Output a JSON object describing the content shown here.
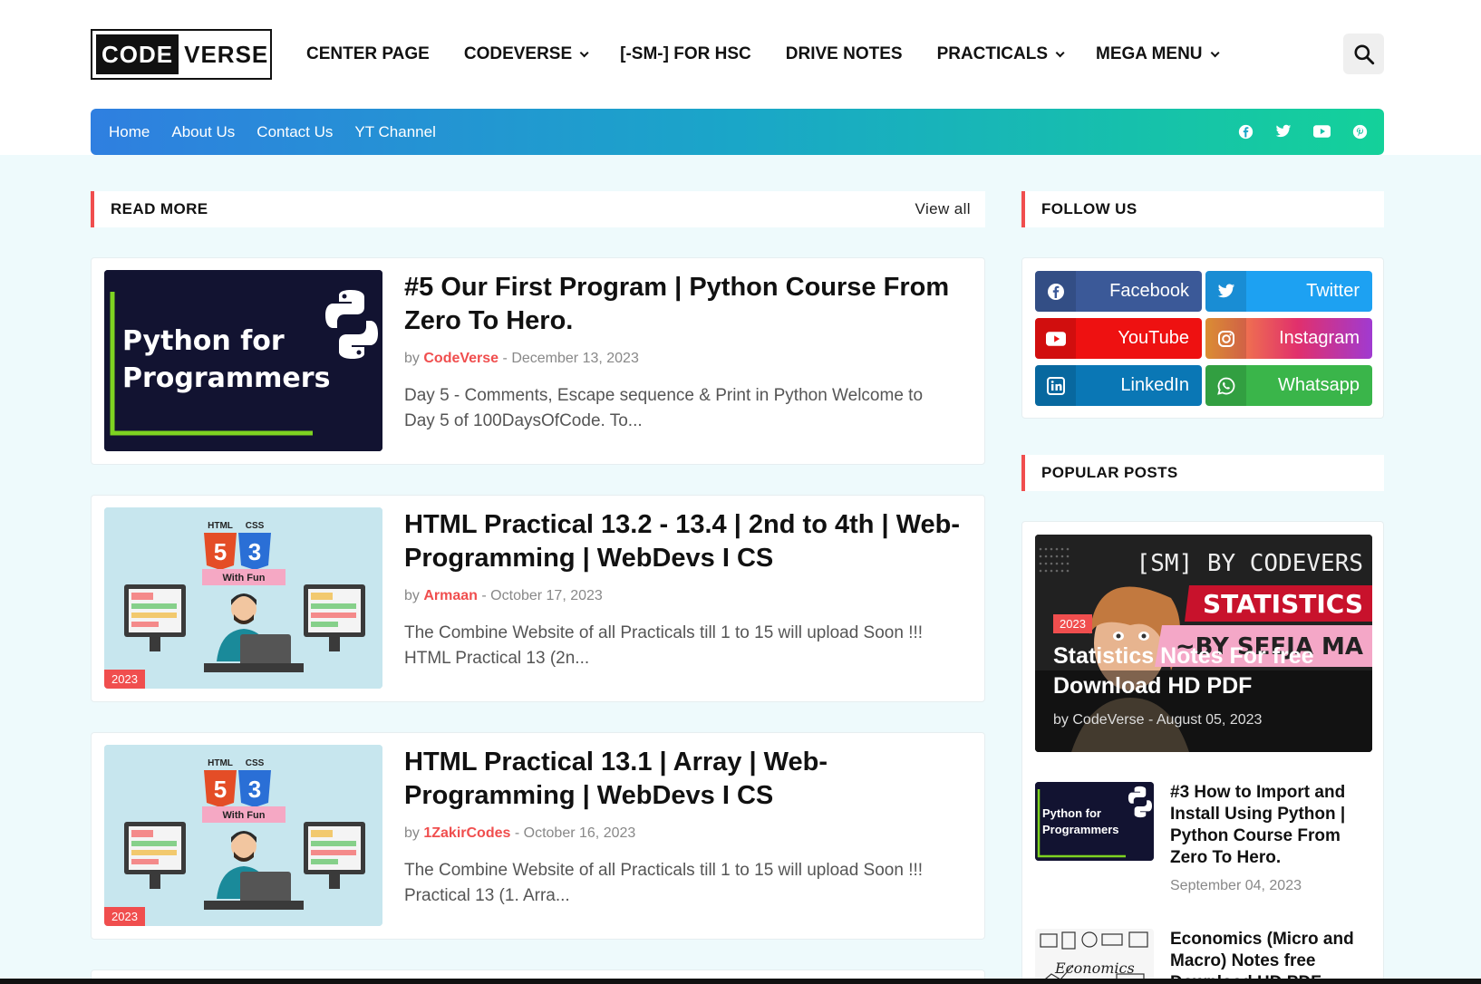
{
  "logo": {
    "part1": "CODE",
    "part2": "VERSE"
  },
  "main_nav": [
    {
      "label": "CENTER PAGE",
      "dropdown": false
    },
    {
      "label": "CODEVERSE",
      "dropdown": true
    },
    {
      "label": "[-SM-] FOR HSC",
      "dropdown": false
    },
    {
      "label": "DRIVE NOTES",
      "dropdown": false
    },
    {
      "label": "PRACTICALS",
      "dropdown": true
    },
    {
      "label": "MEGA MENU",
      "dropdown": true
    }
  ],
  "search_icon": "search-icon",
  "sub_nav": [
    "Home",
    "About Us",
    "Contact Us",
    "YT Channel"
  ],
  "social_mini_icons": [
    "facebook-icon",
    "twitter-icon",
    "youtube-icon",
    "pinterest-icon"
  ],
  "read_more": {
    "heading": "READ MORE",
    "view_all": "View all"
  },
  "posts": [
    {
      "title": "#5 Our First Program | Python Course From Zero To Hero.",
      "by": "by",
      "author": "CodeVerse",
      "sep": "-",
      "date": "December 13, 2023",
      "snippet": "Day 5 - Comments, Escape sequence & Print in Python Welcome to Day 5 of 100DaysOfCode. To...",
      "thumb_text": "Python for Programmers",
      "badge": ""
    },
    {
      "title": "HTML Practical 13.2 - 13.4 | 2nd to 4th | Web-Programming | WebDevs I CS",
      "by": "by",
      "author": "Armaan",
      "sep": "-",
      "date": "October 17, 2023",
      "snippet": "The Combine Website of all Practicals till 1 to 15 will upload Soon !!! HTML Practical 13 (2n...",
      "badge": "2023"
    },
    {
      "title": "HTML Practical 13.1 | Array | Web-Programming | WebDevs I CS",
      "by": "by",
      "author": "1ZakirCodes",
      "sep": "-",
      "date": "October 16, 2023",
      "snippet": "The Combine Website of all Practicals till 1 to 15 will upload Soon !!! Practical 13 (1. Arra...",
      "badge": "2023"
    }
  ],
  "thumb_labels": {
    "html": "HTML",
    "css": "CSS",
    "with_fun": "With Fun",
    "five": "5",
    "three": "3"
  },
  "follow": {
    "heading": "FOLLOW US",
    "buttons": [
      {
        "label": "Facebook",
        "icon": "facebook-icon",
        "color": "#3b5998"
      },
      {
        "label": "Twitter",
        "icon": "twitter-icon",
        "color": "#1da1f2"
      },
      {
        "label": "YouTube",
        "icon": "youtube-icon",
        "color": "#ee1111"
      },
      {
        "label": "Instagram",
        "icon": "instagram-icon",
        "color": "#e1306c"
      },
      {
        "label": "LinkedIn",
        "icon": "linkedin-icon",
        "color": "#0a77b5"
      },
      {
        "label": "Whatsapp",
        "icon": "whatsapp-icon",
        "color": "#3ab54a"
      }
    ]
  },
  "popular": {
    "heading": "POPULAR POSTS",
    "featured": {
      "banner_line1": "[SM] BY CODEVERS",
      "banner_line2": "STATISTICS",
      "banner_line3": "~BY SEEJA MA",
      "badge": "2023",
      "title": "Statistics Notes For free Download HD PDF",
      "by": "by",
      "author": "CodeVerse",
      "sep": "-",
      "date": "August 05, 2023"
    },
    "items": [
      {
        "title": "#3 How to Import and Install Using Python | Python Course From Zero To Hero.",
        "date": "September 04, 2023",
        "thumb_text": "Python for Programmers"
      },
      {
        "title": "Economics (Micro and Macro) Notes free Download HD PDF",
        "date": "",
        "thumb_text": "Economics"
      }
    ]
  },
  "colors": {
    "accent": "#f04e4e",
    "bg": "#eefafc"
  }
}
